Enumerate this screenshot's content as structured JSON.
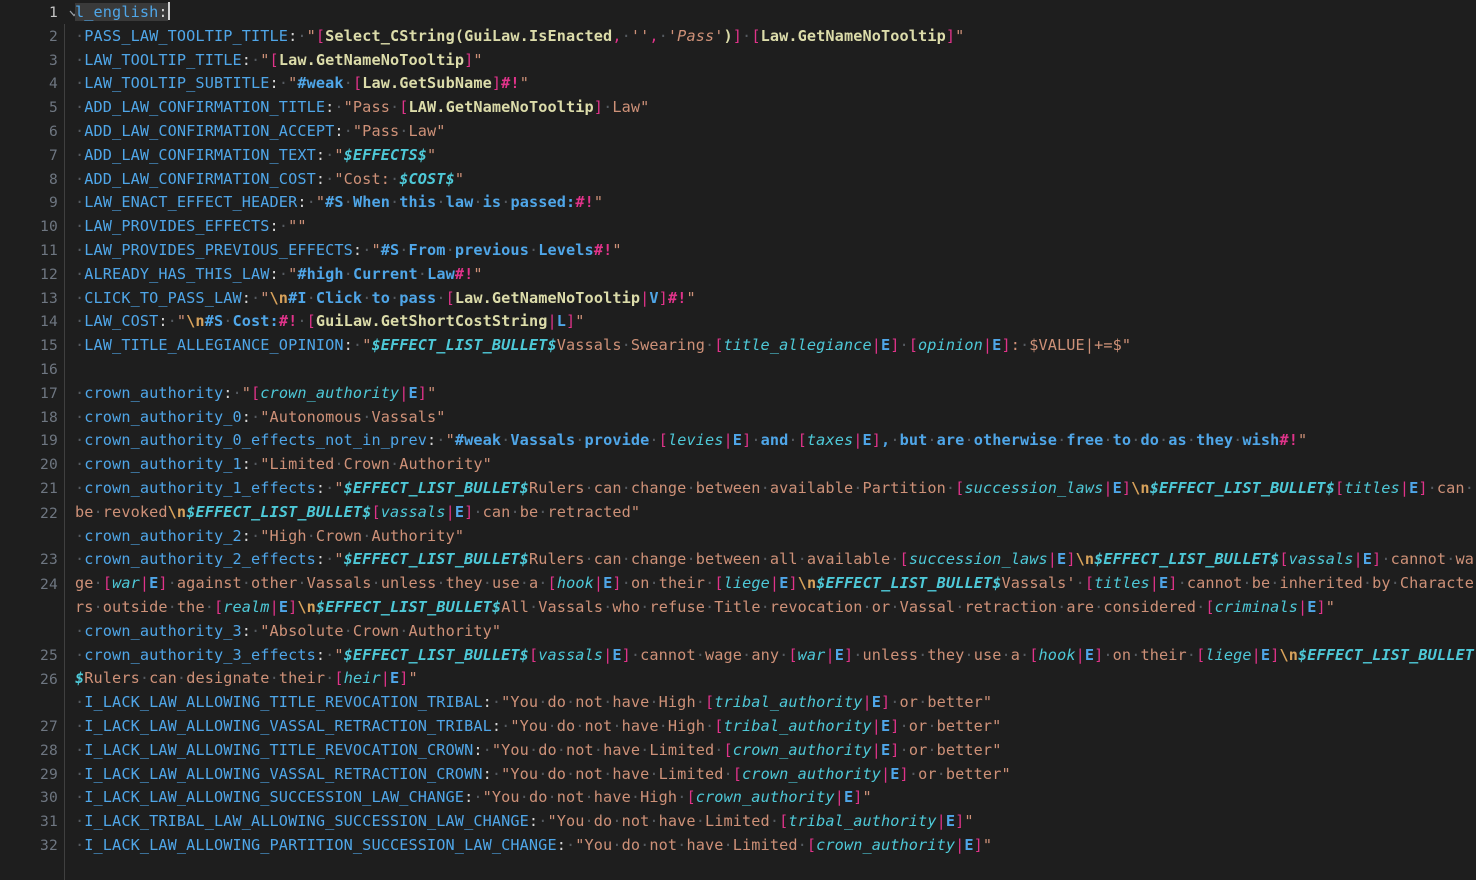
{
  "editor": {
    "language": "yaml",
    "file_root_key": "l_english:",
    "caret_line": 1,
    "colors": {
      "background": "#1e1e1e",
      "gutter_number": "#6e7681",
      "active_line_number": "#c6c6c6",
      "key": "#4fa6e8",
      "string": "#ce9178",
      "bracket": "#e0338a",
      "function": "#dcdcaa",
      "variable": "#4ec9d8",
      "escape": "#d7a25b",
      "indent_guide": "#404040",
      "selection": "#3a3a3a"
    },
    "fold_icon": "chevron-down-icon"
  },
  "gutter": {
    "line_numbers": [
      "1",
      "2",
      "3",
      "4",
      "5",
      "6",
      "7",
      "8",
      "9",
      "10",
      "11",
      "12",
      "13",
      "14",
      "15",
      "16",
      "17",
      "18",
      "19",
      "20",
      "21",
      "22",
      "23",
      "24",
      "25",
      "26",
      "27",
      "28",
      "29",
      "30",
      "31",
      "32"
    ]
  },
  "lines": {
    "l1": "l_english:",
    "l2": "PASS_LAW_TOOLTIP_TITLE: \"[Select_CString(GuiLaw.IsEnacted, '', 'Pass')] [Law.GetNameNoTooltip]\"",
    "l3": "LAW_TOOLTIP_TITLE: \"[Law.GetNameNoTooltip]\"",
    "l4": "LAW_TOOLTIP_SUBTITLE: \"#weak [Law.GetSubName]#!\"",
    "l5": "ADD_LAW_CONFIRMATION_TITLE: \"Pass [LAW.GetNameNoTooltip] Law\"",
    "l6": "ADD_LAW_CONFIRMATION_ACCEPT: \"Pass Law\"",
    "l7": "ADD_LAW_CONFIRMATION_TEXT: \"$EFFECTS$\"",
    "l8": "ADD_LAW_CONFIRMATION_COST: \"Cost: $COST$\"",
    "l9": "LAW_ENACT_EFFECT_HEADER: \"#S When this law is passed:#!\"",
    "l10": "LAW_PROVIDES_EFFECTS: \"\"",
    "l11": "LAW_PROVIDES_PREVIOUS_EFFECTS: \"#S From previous Levels#!\"",
    "l12": "ALREADY_HAS_THIS_LAW: \"#high Current Law#!\"",
    "l13": "CLICK_TO_PASS_LAW: \"\\n#I Click to pass [Law.GetNameNoTooltip|V]#!\"",
    "l14": "LAW_COST: \"\\n#S Cost:#! [GuiLaw.GetShortCostString|L]\"",
    "l15": "LAW_TITLE_ALLEGIANCE_OPINION: \"$EFFECT_LIST_BULLET$Vassals Swearing [title_allegiance|E] [opinion|E]: $VALUE|+=$\"",
    "l16": "",
    "l17": "crown_authority: \"[crown_authority|E]\"",
    "l18": "crown_authority_0: \"Autonomous Vassals\"",
    "l19": "crown_authority_0_effects_not_in_prev: \"#weak Vassals provide [levies|E] and [taxes|E], but are otherwise free to do as they wish#!\"",
    "l20": "crown_authority_1: \"Limited Crown Authority\"",
    "l21": "crown_authority_1_effects: \"$EFFECT_LIST_BULLET$Rulers can change between available Partition [succession_laws|E]\\n$EFFECT_LIST_BULLET$[titles|E] can be revoked\\n$EFFECT_LIST_BULLET$[vassals|E] can be retracted\"",
    "l22": "crown_authority_2: \"High Crown Authority\"",
    "l23": "crown_authority_2_effects: \"$EFFECT_LIST_BULLET$Rulers can change between all available [succession_laws|E]\\n$EFFECT_LIST_BULLET$[vassals|E] cannot wage [war|E] against other Vassals unless they use a [hook|E] on their [liege|E]\\n$EFFECT_LIST_BULLET$Vassals' [titles|E] cannot be inherited by Characters outside the [realm|E]\\n$EFFECT_LIST_BULLET$All Vassals who refuse Title revocation or Vassal retraction are considered [criminals|E]\"",
    "l24": "crown_authority_3: \"Absolute Crown Authority\"",
    "l25": "crown_authority_3_effects: \"$EFFECT_LIST_BULLET$[vassals|E] cannot wage any [war|E] unless they use a [hook|E] on their [liege|E]\\n$EFFECT_LIST_BULLET$Rulers can designate their [heir|E]\"",
    "l26": "I_LACK_LAW_ALLOWING_TITLE_REVOCATION_TRIBAL: \"You do not have High [tribal_authority|E] or better\"",
    "l27": "I_LACK_LAW_ALLOWING_VASSAL_RETRACTION_TRIBAL: \"You do not have High [tribal_authority|E] or better\"",
    "l28": "I_LACK_LAW_ALLOWING_TITLE_REVOCATION_CROWN: \"You do not have Limited [crown_authority|E] or better\"",
    "l29": "I_LACK_LAW_ALLOWING_VASSAL_RETRACTION_CROWN: \"You do not have Limited [crown_authority|E] or better\"",
    "l30": "I_LACK_LAW_ALLOWING_SUCCESSION_LAW_CHANGE: \"You do not have High [crown_authority|E]\"",
    "l31": "I_LACK_TRIBAL_LAW_ALLOWING_SUCCESSION_LAW_CHANGE: \"You do not have Limited [tribal_authority|E]\"",
    "l32": "I_LACK_LAW_ALLOWING_PARTITION_SUCCESSION_LAW_CHANGE: \"You do not have Limited [crown_authority|E]\""
  },
  "tokens": {
    "keys": {
      "l1": "l_english",
      "l2": "PASS_LAW_TOOLTIP_TITLE",
      "l3": "LAW_TOOLTIP_TITLE",
      "l4": "LAW_TOOLTIP_SUBTITLE",
      "l5": "ADD_LAW_CONFIRMATION_TITLE",
      "l6": "ADD_LAW_CONFIRMATION_ACCEPT",
      "l7": "ADD_LAW_CONFIRMATION_TEXT",
      "l8": "ADD_LAW_CONFIRMATION_COST",
      "l9": "LAW_ENACT_EFFECT_HEADER",
      "l10": "LAW_PROVIDES_EFFECTS",
      "l11": "LAW_PROVIDES_PREVIOUS_EFFECTS",
      "l12": "ALREADY_HAS_THIS_LAW",
      "l13": "CLICK_TO_PASS_LAW",
      "l14": "LAW_COST",
      "l15": "LAW_TITLE_ALLEGIANCE_OPINION",
      "l17": "crown_authority",
      "l18": "crown_authority_0",
      "l19": "crown_authority_0_effects_not_in_prev",
      "l20": "crown_authority_1",
      "l21": "crown_authority_1_effects",
      "l22": "crown_authority_2",
      "l23": "crown_authority_2_effects",
      "l24": "crown_authority_3",
      "l25": "crown_authority_3_effects",
      "l26": "I_LACK_LAW_ALLOWING_TITLE_REVOCATION_TRIBAL",
      "l27": "I_LACK_LAW_ALLOWING_VASSAL_RETRACTION_TRIBAL",
      "l28": "I_LACK_LAW_ALLOWING_TITLE_REVOCATION_CROWN",
      "l29": "I_LACK_LAW_ALLOWING_VASSAL_RETRACTION_CROWN",
      "l30": "I_LACK_LAW_ALLOWING_SUCCESSION_LAW_CHANGE",
      "l31": "I_LACK_TRIBAL_LAW_ALLOWING_SUCCESSION_LAW_CHANGE",
      "l32": "I_LACK_LAW_ALLOWING_PARTITION_SUCCESSION_LAW_CHANGE"
    }
  }
}
